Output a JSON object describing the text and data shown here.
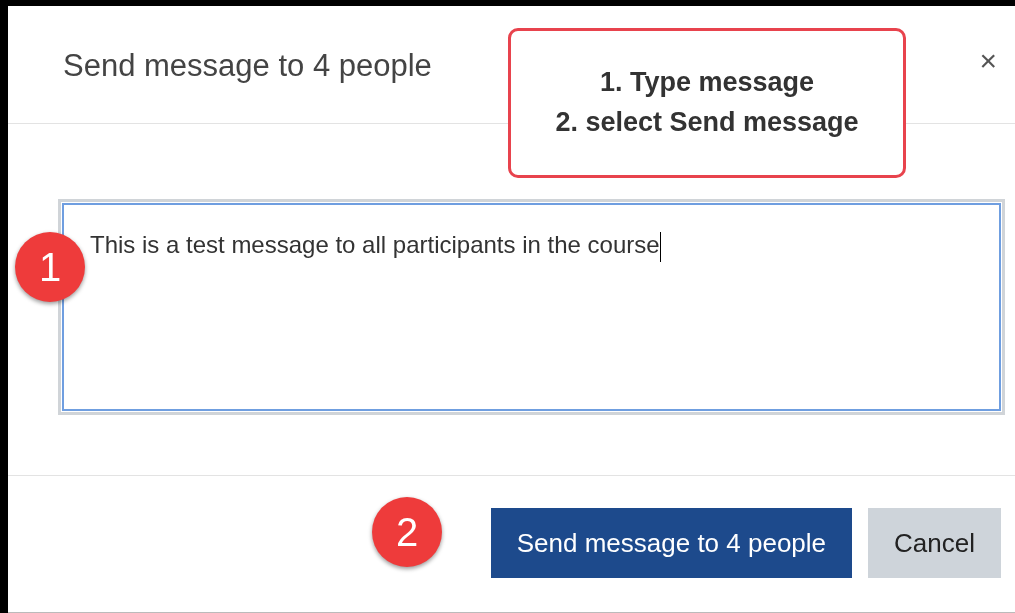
{
  "dialog": {
    "title": "Send message to 4 people",
    "close": "×",
    "message": "This is a test message to all participants in the course"
  },
  "annotation": {
    "lines": [
      "1. Type message",
      "2. select Send message"
    ]
  },
  "steps": [
    "1",
    "2"
  ],
  "buttons": [
    {
      "kind": "primary",
      "label": "Send message to 4 people"
    },
    {
      "kind": "secondary",
      "label": "Cancel"
    }
  ]
}
